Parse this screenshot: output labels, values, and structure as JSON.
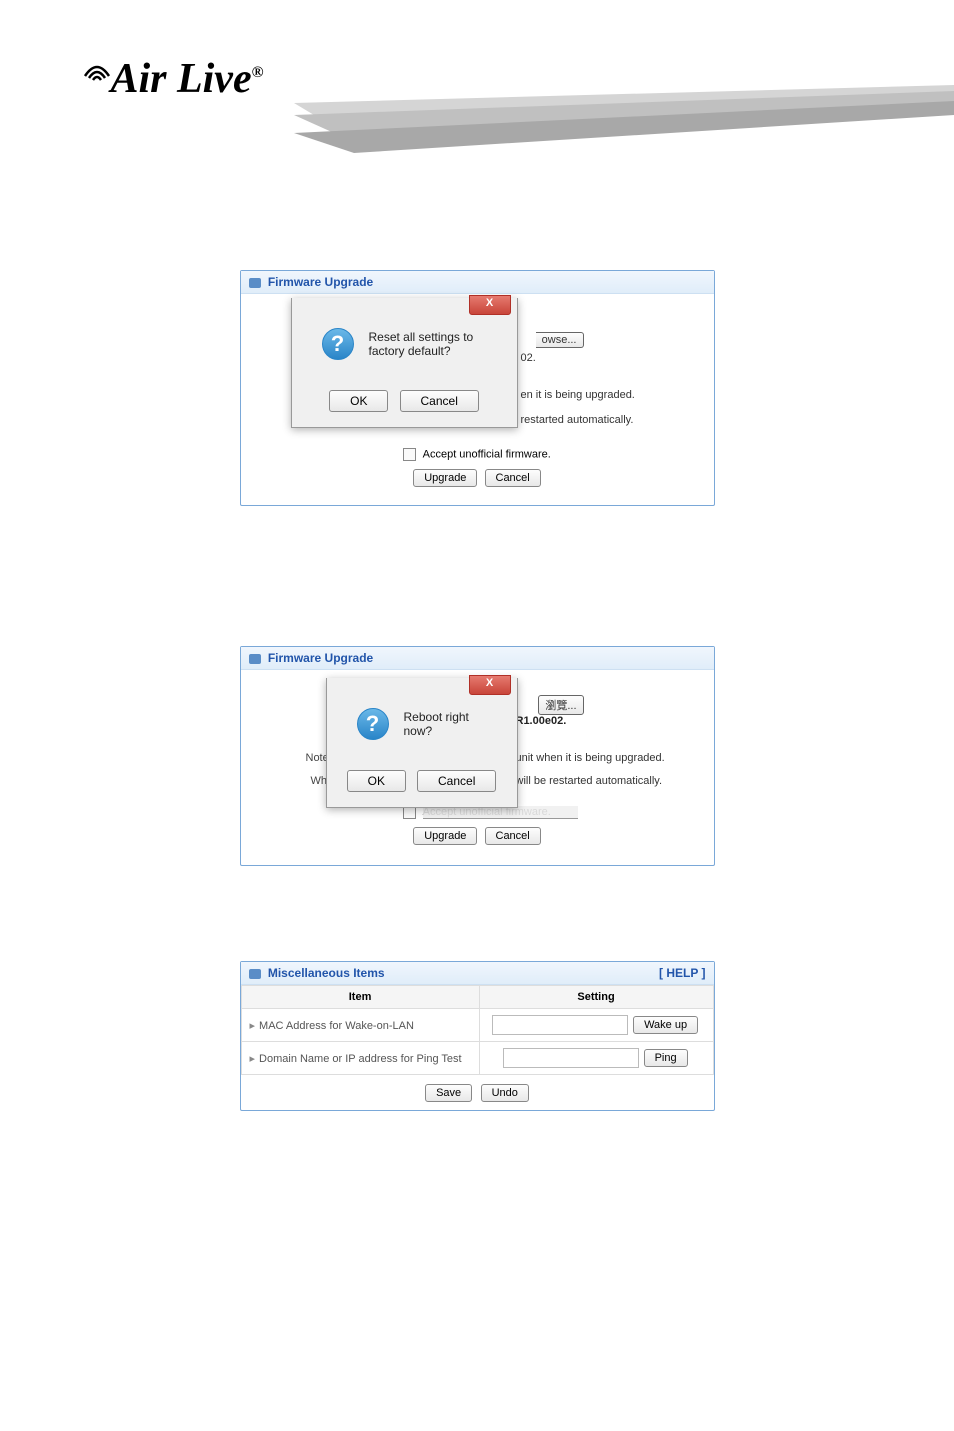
{
  "logo": {
    "text_a": "A",
    "text_rest": "ir Live",
    "reg": "®"
  },
  "panel1": {
    "title": "Firmware Upgrade",
    "dialog": {
      "message": "Reset all settings to factory default?",
      "ok": "OK",
      "cancel": "Cancel",
      "close": "X"
    },
    "bg": {
      "browse_partial": "owse...",
      "ver_partial": "02.",
      "upgrading": "en it is being upgraded.",
      "restarted": "restarted automatically."
    },
    "checkbox_label": "Accept unofficial firmware.",
    "upgrade_btn": "Upgrade",
    "cancel_btn": "Cancel"
  },
  "panel2": {
    "title": "Firmware Upgrade",
    "dialog": {
      "message": "Reboot right now?",
      "ok": "OK",
      "cancel": "Cancel",
      "close": "X"
    },
    "bg": {
      "browse": "瀏覽...",
      "version": "R1.00e02.",
      "note_label": "Note",
      "w_label": "Wh",
      "upgrading": "unit when it is being upgraded.",
      "restarted": "will be restarted automatically."
    },
    "checkbox_label": "Accept unofficial firmware.",
    "upgrade_btn": "Upgrade",
    "cancel_btn": "Cancel"
  },
  "panel3": {
    "title": "Miscellaneous Items",
    "help": "[ HELP ]",
    "col_item": "Item",
    "col_setting": "Setting",
    "rows": [
      {
        "label": "MAC Address for Wake-on-LAN",
        "button": "Wake up"
      },
      {
        "label": "Domain Name or IP address for Ping Test",
        "button": "Ping"
      }
    ],
    "save_btn": "Save",
    "undo_btn": "Undo"
  }
}
